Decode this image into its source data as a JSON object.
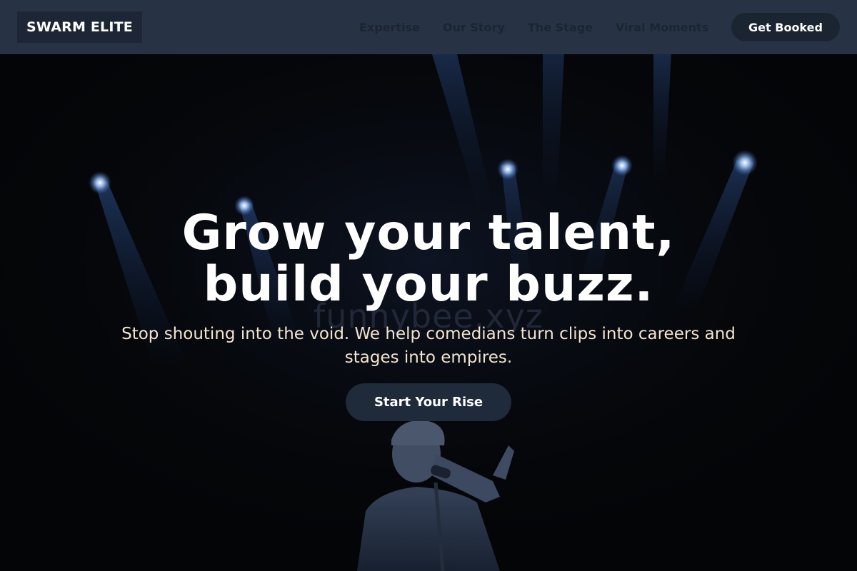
{
  "header": {
    "logo_text": "SWARM ELITE",
    "nav": [
      {
        "label": "Expertise"
      },
      {
        "label": "Our Story"
      },
      {
        "label": "The Stage"
      },
      {
        "label": "Viral Moments"
      }
    ],
    "cta_label": "Get Booked"
  },
  "hero": {
    "headline_line1": "Grow your talent,",
    "headline_line2": "build your buzz.",
    "subheadline": "Stop shouting into the void. We help comedians turn clips into careers and stages into empires.",
    "cta_label": "Start Your Rise",
    "watermark": "funnybee.xyz",
    "background_image": "stage-performer-with-microphone-under-blue-spotlights"
  },
  "colors": {
    "navbar_bg": "#273244",
    "logo_bg": "#1d2634",
    "nav_link": "#1b2431",
    "button_bg": "#1b2431",
    "headline": "#ffffff",
    "subheadline": "#f4e4cf",
    "spotlight": "#4f86d8"
  }
}
